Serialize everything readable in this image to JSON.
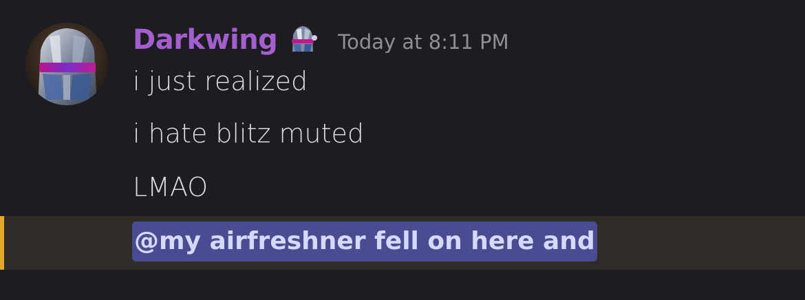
{
  "message": {
    "author": {
      "name": "Darkwing",
      "name_color": "#a25fcd",
      "avatar_icon": "robot-helmet-avatar",
      "role_icon": "helmet-role-icon"
    },
    "timestamp": "Today at 8:11 PM",
    "lines": [
      "i just realized",
      "i hate blitz muted",
      "LMAO"
    ],
    "mention": {
      "text": "@my airfreshner fell on here and",
      "highlight_color": "#e5a72a"
    }
  },
  "colors": {
    "background": "#1c1c21",
    "text": "#dbdee1",
    "timestamp": "#8e9097",
    "mention_bg": "#4a4c92",
    "highlight_row_bg": "#302c28"
  }
}
